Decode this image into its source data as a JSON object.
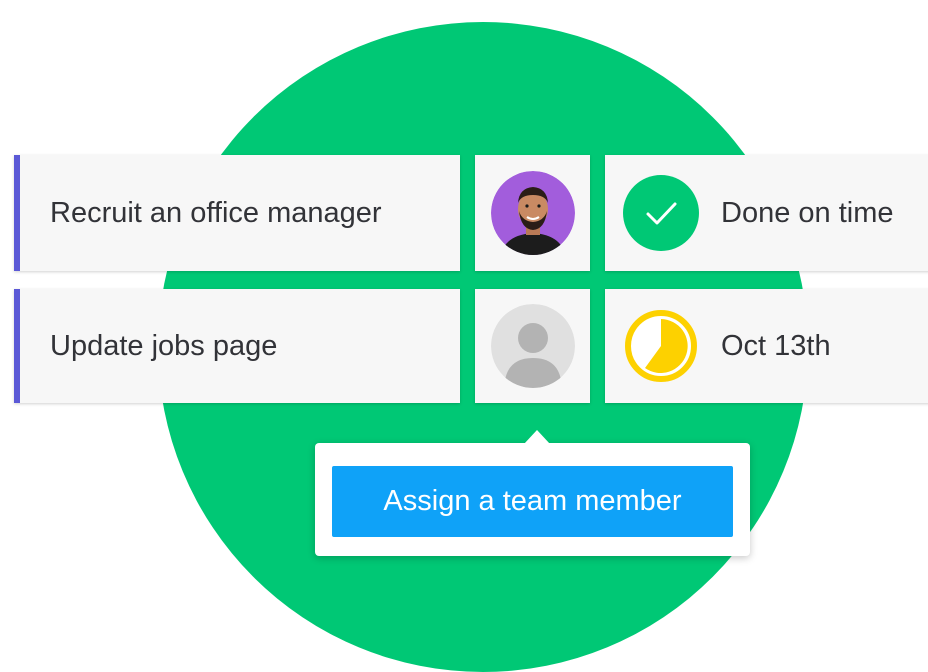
{
  "colors": {
    "background_circle": "#00c875",
    "task_accent": "#5b59d6",
    "done_status": "#00c875",
    "due_status": "#fdd100",
    "assign_button": "#0fa2f8",
    "avatar_background": "#a25ddc"
  },
  "tasks": [
    {
      "title": "Recruit an office manager",
      "person": "photo-avatar",
      "status_icon": "checkmark-icon",
      "status_text": "Done on time"
    },
    {
      "title": "Update jobs page",
      "person": "empty-user-icon",
      "status_icon": "pie-progress-icon",
      "status_text": "Oct 13th"
    }
  ],
  "popover": {
    "button_label": "Assign a team member"
  }
}
